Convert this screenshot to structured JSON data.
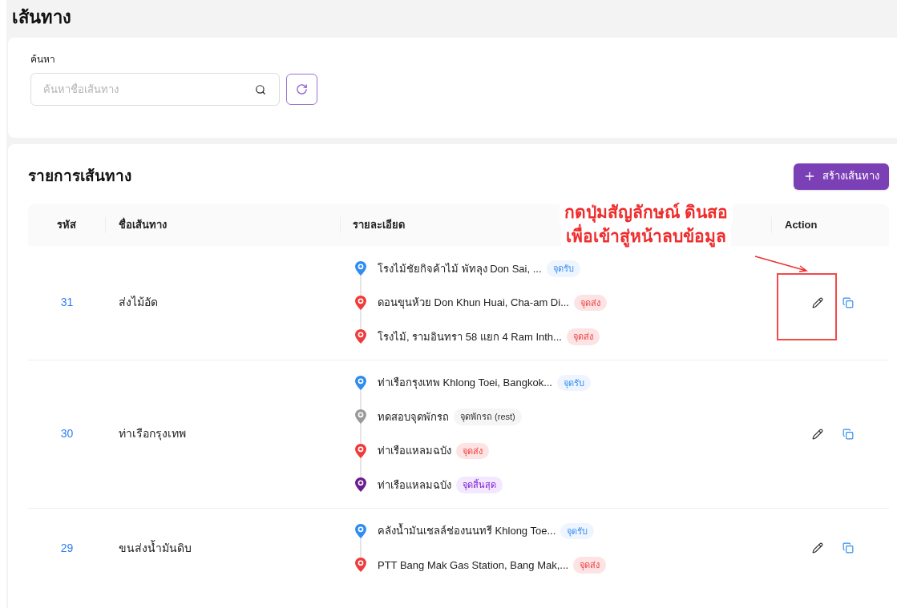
{
  "page_title": "เส้นทาง",
  "search": {
    "label": "ค้นหา",
    "placeholder": "ค้นหาชื่อเส้นทาง"
  },
  "list": {
    "title": "รายการเส้นทาง",
    "create_button": "สร้างเส้นทาง"
  },
  "table": {
    "columns": [
      "รหัส",
      "ชื่อเส้นทาง",
      "รายละเอียด",
      "Action"
    ],
    "rows": [
      {
        "code": "31",
        "name": "ส่งไม้อัด",
        "stops": [
          {
            "kind": "pickup",
            "text": "โรงไม้ชัยกิจค้าไม้ พัทลุง Don Sai, ...",
            "badge": "จุดรับ"
          },
          {
            "kind": "dropoff",
            "text": "ดอนขุนห้วย Don Khun Huai, Cha-am Di...",
            "badge": "จุดส่ง"
          },
          {
            "kind": "dropoff",
            "text": "โรงไม้, รามอินทรา 58 แยก 4 Ram Inth...",
            "badge": "จุดส่ง"
          }
        ]
      },
      {
        "code": "30",
        "name": "ท่าเรือกรุงเทพ",
        "stops": [
          {
            "kind": "pickup",
            "text": "ท่าเรือกรุงเทพ Khlong Toei, Bangkok...",
            "badge": "จุดรับ"
          },
          {
            "kind": "rest",
            "text": "ทดสอบจุดพักรถ",
            "badge": "จุดพักรถ (rest)"
          },
          {
            "kind": "dropoff",
            "text": "ท่าเรือแหลมฉบัง",
            "badge": "จุดส่ง"
          },
          {
            "kind": "end",
            "text": "ท่าเรือแหลมฉบัง",
            "badge": "จุดสิ้นสุด"
          }
        ]
      },
      {
        "code": "29",
        "name": "ขนส่งน้ำมันดิบ",
        "stops": [
          {
            "kind": "pickup",
            "text": "คลังน้ำมันเชลล์ช่องนนทรี Khlong Toe...",
            "badge": "จุดรับ"
          },
          {
            "kind": "dropoff",
            "text": "PTT Bang Mak Gas Station, Bang Mak,...",
            "badge": "จุดส่ง"
          }
        ]
      }
    ]
  },
  "annotation": {
    "lines": [
      "กดปุ่มสัญลักษณ์ ดินสอ",
      "เพื่อเข้าสู่หน้าลบข้อมูล"
    ]
  }
}
